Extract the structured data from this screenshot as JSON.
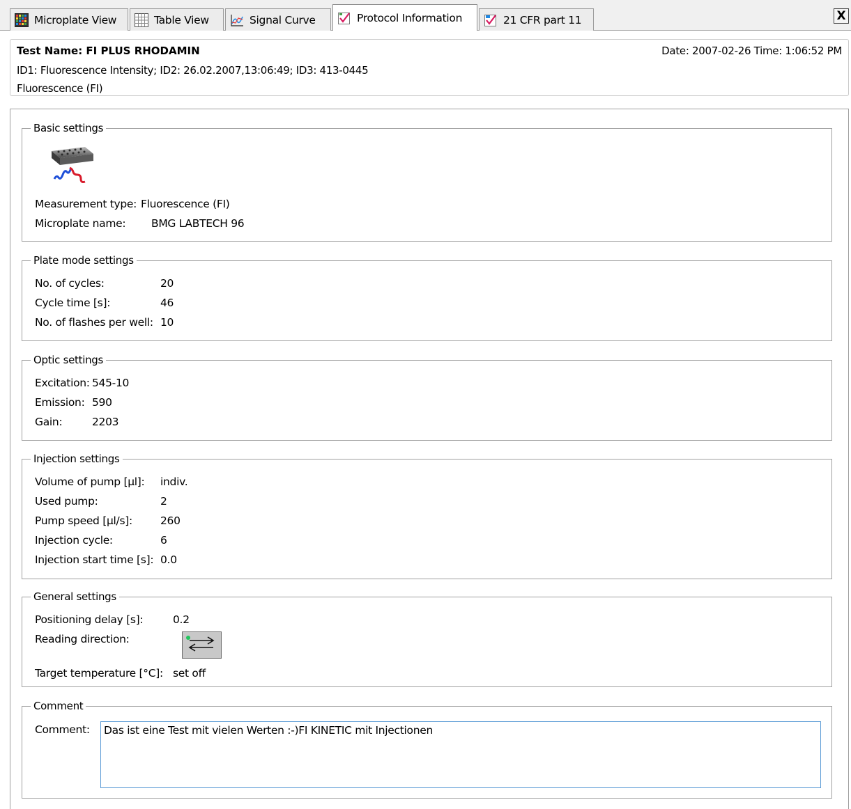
{
  "tabs": [
    {
      "label": "Microplate View",
      "icon": "microplate-grid-icon",
      "active": false
    },
    {
      "label": "Table View",
      "icon": "table-icon",
      "active": false
    },
    {
      "label": "Signal Curve",
      "icon": "signal-curve-icon",
      "active": false
    },
    {
      "label": "Protocol Information",
      "icon": "protocol-check-icon",
      "active": true
    },
    {
      "label": "21 CFR part 11",
      "icon": "cfr-check-icon",
      "active": false
    }
  ],
  "close_label": "X",
  "header": {
    "title": "Test Name: FI PLUS RHODAMIN",
    "date": "Date: 2007-02-26  Time: 1:06:52 PM",
    "ids": "ID1: Fluorescence Intensity; ID2: 26.02.2007,13:06:49; ID3: 413-0445",
    "mode": "Fluorescence (FI)"
  },
  "basic": {
    "legend": "Basic settings",
    "icon": "fluorescence-plate-icon",
    "measurement_type_label": "Measurement type:",
    "measurement_type_value": "Fluorescence (FI)",
    "microplate_label": "Microplate name:",
    "microplate_value": "BMG LABTECH 96"
  },
  "plate_mode": {
    "legend": "Plate mode settings",
    "rows": [
      {
        "label": "No. of cycles:",
        "value": "20"
      },
      {
        "label": "Cycle time [s]:",
        "value": "46"
      },
      {
        "label": "No. of flashes per well:",
        "value": "10"
      }
    ]
  },
  "optic": {
    "legend": "Optic settings",
    "rows": [
      {
        "label": "Excitation:",
        "value": "545-10"
      },
      {
        "label": "Emission:",
        "value": "590"
      },
      {
        "label": "Gain:",
        "value": "2203"
      }
    ]
  },
  "injection": {
    "legend": "Injection settings",
    "rows": [
      {
        "label": "Volume of pump [µl]:",
        "value": "indiv."
      },
      {
        "label": "Used pump:",
        "value": "2"
      },
      {
        "label": "Pump speed [µl/s]:",
        "value": "260"
      },
      {
        "label": "Injection cycle:",
        "value": "6"
      },
      {
        "label": "Injection start time [s]:",
        "value": "0.0"
      }
    ]
  },
  "general": {
    "legend": "General settings",
    "positioning_label": "Positioning delay [s]:",
    "positioning_value": "0.2",
    "reading_label": "Reading direction:",
    "reading_icon": "reading-direction-icon",
    "temperature_label": "Target temperature [°C]:",
    "temperature_value": "set off"
  },
  "comment": {
    "legend": "Comment",
    "label": "Comment:",
    "value": "Das ist eine Test mit vielen Werten :-)FI KINETIC mit Injectionen"
  }
}
